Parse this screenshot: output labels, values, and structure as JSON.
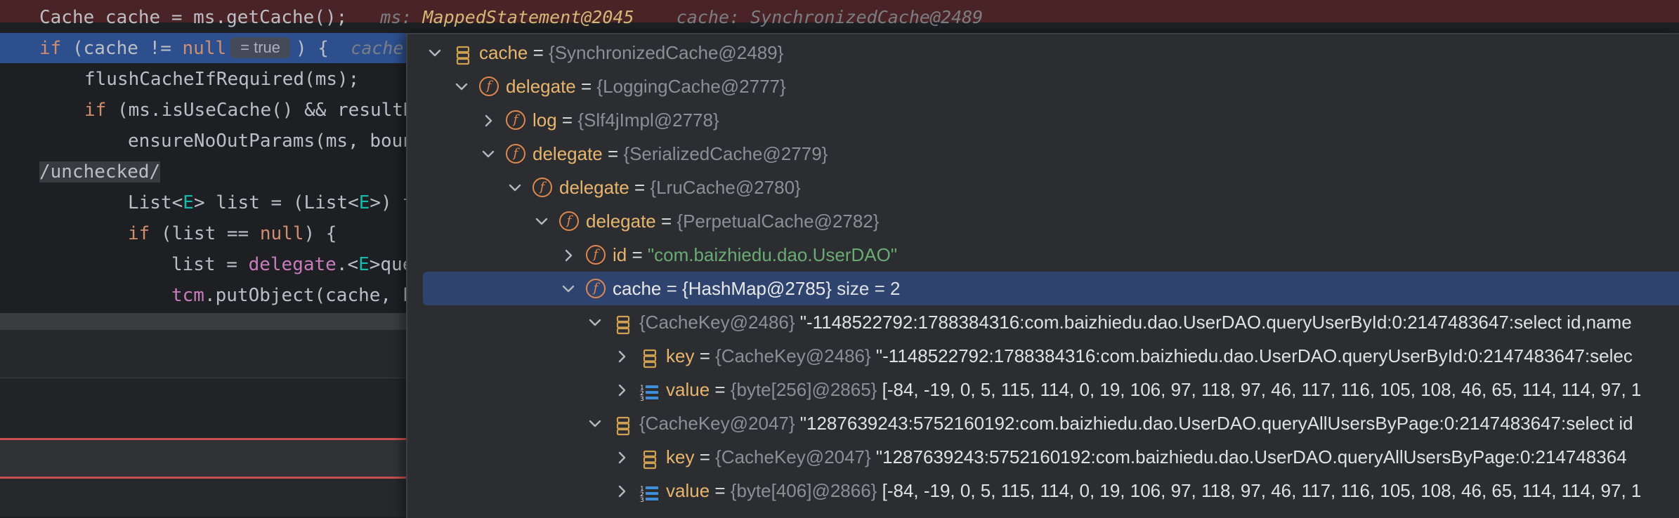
{
  "editor": {
    "lines": [
      {
        "code": "Cache cache = ms.getCache();",
        "hint_ms_label": "ms:",
        "hint_ms_value": "MappedStatement@2045",
        "hint_cache_label": "cache:",
        "hint_cache_value": "SynchronizedCache@2489"
      },
      {
        "kw_if": "if",
        "code_a": " (cache != ",
        "kw_null": "null",
        "inline_value": "= true",
        "code_b": ") {",
        "hint": "cache"
      },
      {
        "code": "flushCacheIfRequired(ms);"
      },
      {
        "kw_if": "if",
        "code": " (ms.isUseCache() && resultH"
      },
      {
        "code": "ensureNoOutParams(ms, boun"
      },
      {
        "code": "/unchecked/"
      },
      {
        "code_a": "List<",
        "gen_a": "E",
        "code_b": "> list = (List<",
        "gen_b": "E",
        "code_c": ">) t"
      },
      {
        "kw_if": "if",
        "code": " (list == ",
        "kw_null": "null",
        "code_end": ") {"
      },
      {
        "code_a": "list = ",
        "field": "delegate",
        "code_b": ".<",
        "gen": "E",
        "code_c": ">que"
      },
      {
        "field": "tcm",
        "code": ".putObject(cache, k"
      }
    ]
  },
  "debugger_popup": {
    "nodes": [
      {
        "name": "cache",
        "eq": " = ",
        "type": "{SynchronizedCache@2489}",
        "expanded": true
      },
      {
        "name": "delegate",
        "eq": " = ",
        "type": "{LoggingCache@2777}",
        "expanded": true
      },
      {
        "name": "log",
        "eq": " = ",
        "type": "{Slf4jImpl@2778}",
        "expanded": false
      },
      {
        "name": "delegate",
        "eq": " = ",
        "type": "{SerializedCache@2779}",
        "expanded": true
      },
      {
        "name": "delegate",
        "eq": " = ",
        "type": "{LruCache@2780}",
        "expanded": true
      },
      {
        "name": "delegate",
        "eq": " = ",
        "type": "{PerpetualCache@2782}",
        "expanded": true
      },
      {
        "name": "id",
        "eq": " = ",
        "value": "\"com.baizhiedu.dao.UserDAO\"",
        "expanded": false
      },
      {
        "name": "cache",
        "eq": " = ",
        "type": "{HashMap@2785}",
        "extra": "  size = 2",
        "expanded": true,
        "selected": true
      },
      {
        "type": "{CacheKey@2486}",
        "value": " \"-1148522792:1788384316:com.baizhiedu.dao.UserDAO.queryUserById:0:2147483647:select id,name",
        "expanded": true
      },
      {
        "name": "key",
        "eq": " = ",
        "type": "{CacheKey@2486}",
        "value": " \"-1148522792:1788384316:com.baizhiedu.dao.UserDAO.queryUserById:0:2147483647:selec",
        "expanded": false
      },
      {
        "name": "value",
        "eq": " = ",
        "type": "{byte[256]@2865}",
        "value": " [-84, -19, 0, 5, 115, 114, 0, 19, 106, 97, 118, 97, 46, 117, 116, 105, 108, 46, 65, 114, 114, 97, 1",
        "expanded": false
      },
      {
        "type": "{CacheKey@2047}",
        "value": " \"1287639243:5752160192:com.baizhiedu.dao.UserDAO.queryAllUsersByPage:0:2147483647:select id",
        "expanded": true
      },
      {
        "name": "key",
        "eq": " = ",
        "type": "{CacheKey@2047}",
        "value": " \"1287639243:5752160192:com.baizhiedu.dao.UserDAO.queryAllUsersByPage:0:214748364",
        "expanded": false
      },
      {
        "name": "value",
        "eq": " = ",
        "type": "{byte[406]@2866}",
        "value": " [-84, -19, 0, 5, 115, 114, 0, 19, 106, 97, 118, 97, 46, 117, 116, 105, 108, 46, 65, 114, 114, 97, 1",
        "expanded": false
      }
    ]
  },
  "colors": {
    "editor_bg": "#1e1f22",
    "execution_line": "#2d4f8e",
    "error_line": "#4a2326",
    "popup_bg": "#2b2d30",
    "selection": "#2e436e",
    "field_icon": "#e0874f",
    "object_icon": "#d0a152",
    "string": "#6aab73"
  }
}
